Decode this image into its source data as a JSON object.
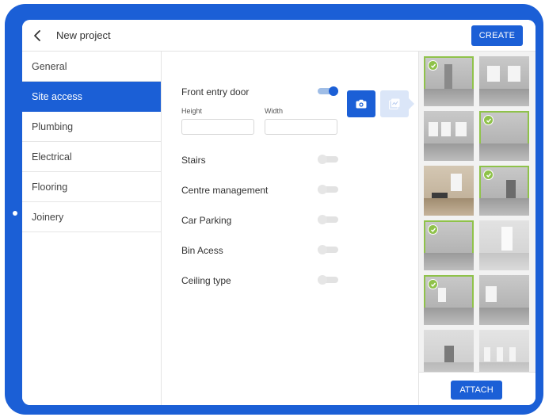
{
  "header": {
    "title": "New project",
    "create_label": "CREATE",
    "back_icon": "chevron-left-icon"
  },
  "sidebar": {
    "items": [
      {
        "label": "General",
        "active": false
      },
      {
        "label": "Site access",
        "active": true
      },
      {
        "label": "Plumbing",
        "active": false
      },
      {
        "label": "Electrical",
        "active": false
      },
      {
        "label": "Flooring",
        "active": false
      },
      {
        "label": "Joinery",
        "active": false
      }
    ]
  },
  "form": {
    "front_entry_door": {
      "label": "Front entry door",
      "on": true
    },
    "height": {
      "label": "Height",
      "value": ""
    },
    "width": {
      "label": "Width",
      "value": ""
    },
    "camera_icon": "camera-icon",
    "gallery_icon": "gallery-icon",
    "toggles": [
      {
        "label": "Stairs",
        "on": false
      },
      {
        "label": "Centre management",
        "on": false
      },
      {
        "label": "Car Parking",
        "on": false
      },
      {
        "label": "Bin Acess",
        "on": false
      },
      {
        "label": "Ceiling type",
        "on": false
      }
    ]
  },
  "gallery": {
    "photos": [
      {
        "selected": true
      },
      {
        "selected": false
      },
      {
        "selected": false
      },
      {
        "selected": true
      },
      {
        "selected": false
      },
      {
        "selected": true
      },
      {
        "selected": true
      },
      {
        "selected": false
      },
      {
        "selected": true
      },
      {
        "selected": false
      },
      {
        "selected": false
      },
      {
        "selected": false
      }
    ],
    "attach_label": "ATTACH"
  },
  "colors": {
    "accent": "#1b5fd6",
    "selected_outline": "#8fc24a"
  }
}
